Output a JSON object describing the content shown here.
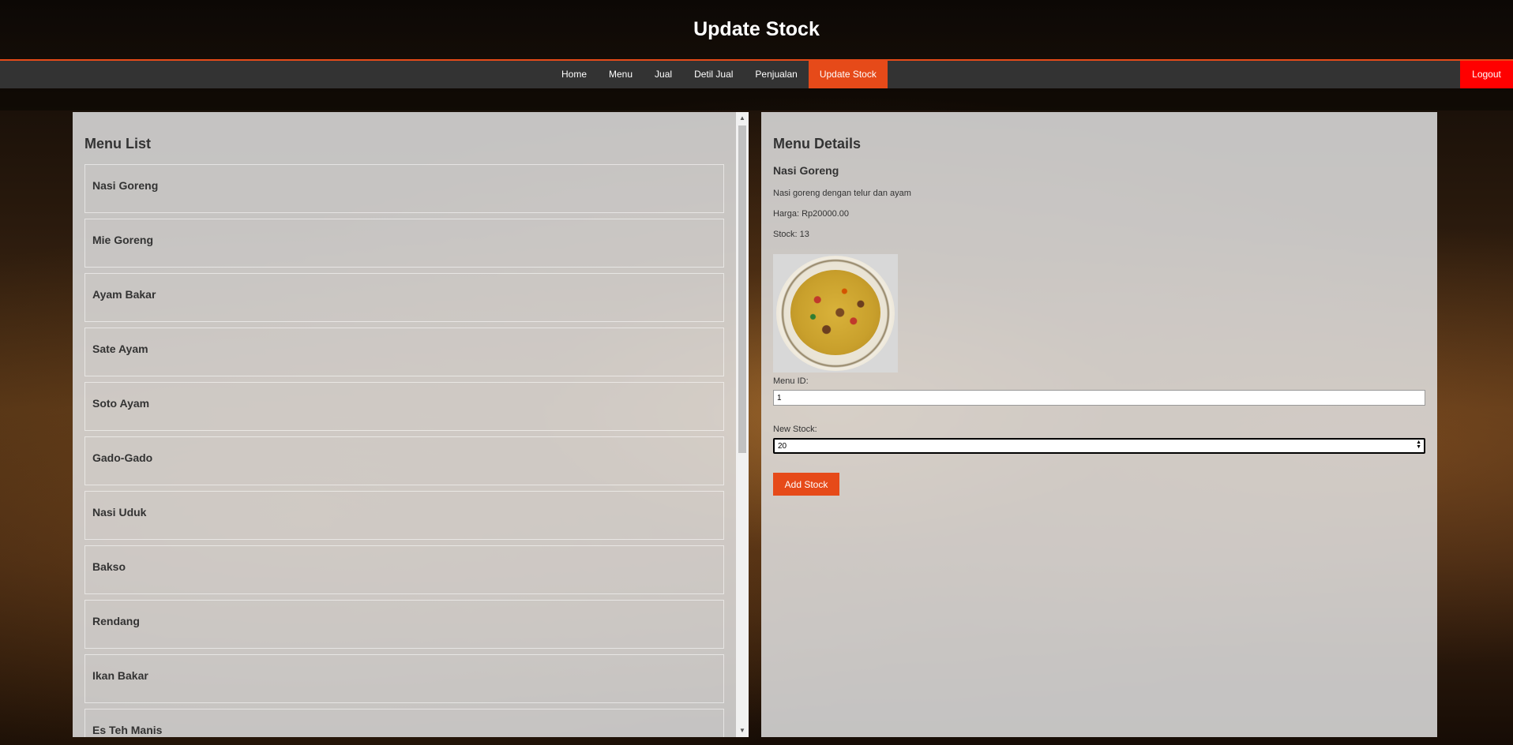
{
  "header": {
    "title": "Update Stock"
  },
  "nav": {
    "items": [
      {
        "label": "Home"
      },
      {
        "label": "Menu"
      },
      {
        "label": "Jual"
      },
      {
        "label": "Detil Jual"
      },
      {
        "label": "Penjualan"
      },
      {
        "label": "Update Stock",
        "active": true
      }
    ],
    "logout": "Logout"
  },
  "menu_list": {
    "title": "Menu List",
    "items": [
      "Nasi Goreng",
      "Mie Goreng",
      "Ayam Bakar",
      "Sate Ayam",
      "Soto Ayam",
      "Gado-Gado",
      "Nasi Uduk",
      "Bakso",
      "Rendang",
      "Ikan Bakar",
      "Es Teh Manis"
    ]
  },
  "details": {
    "title": "Menu Details",
    "name": "Nasi Goreng",
    "description": "Nasi goreng dengan telur dan ayam",
    "price": "Harga: Rp20000.00",
    "stock": "Stock: 13",
    "menu_id_label": "Menu ID:",
    "menu_id_value": "1",
    "new_stock_label": "New Stock:",
    "new_stock_value": "20",
    "add_button": "Add Stock"
  },
  "colors": {
    "accent": "#e64a19",
    "logout": "#ff0000",
    "nav_bg": "#333333"
  },
  "icons": {
    "scroll_up": "triangle-up-icon",
    "scroll_down": "triangle-down-icon",
    "spinner": "spinner-icon"
  }
}
